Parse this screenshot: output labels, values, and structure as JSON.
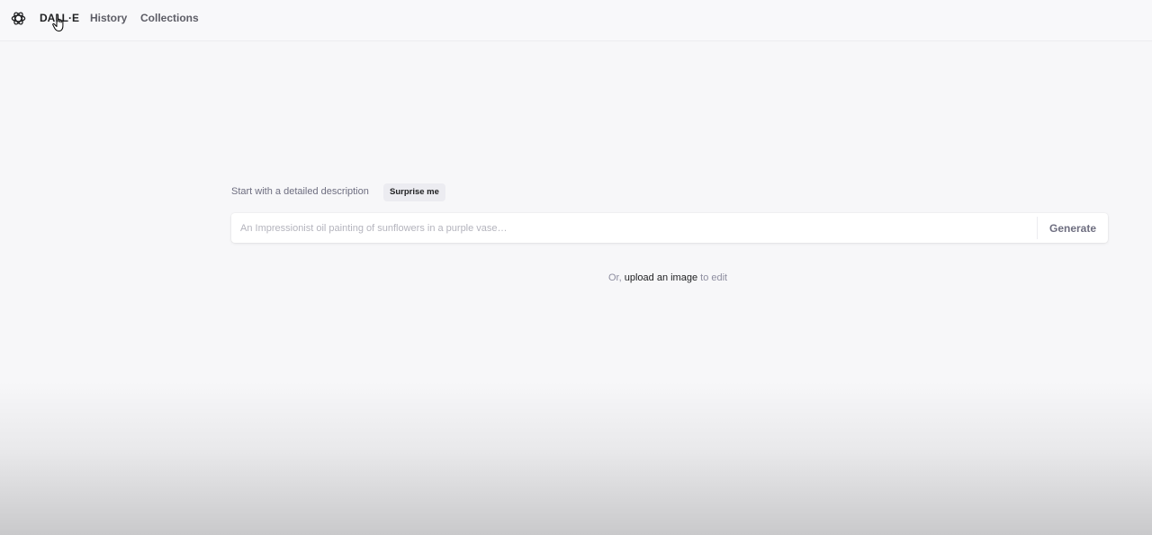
{
  "nav": {
    "logo_icon": "openai-logo-icon",
    "items": [
      {
        "label": "DALL·E",
        "active": true
      },
      {
        "label": "History",
        "active": false
      },
      {
        "label": "Collections",
        "active": false
      }
    ]
  },
  "prompt": {
    "label": "Start with a detailed description",
    "surprise_label": "Surprise me",
    "placeholder": "An Impressionist oil painting of sunflowers in a purple vase…",
    "value": "",
    "generate_label": "Generate"
  },
  "upload": {
    "prefix": "Or,",
    "link_text": "upload an image",
    "suffix": "to edit"
  },
  "cursor_icon": "hand-pointer-icon",
  "colors": {
    "background": "#f7f7f9",
    "text_primary": "#202123",
    "text_secondary": "#6e6e80"
  }
}
